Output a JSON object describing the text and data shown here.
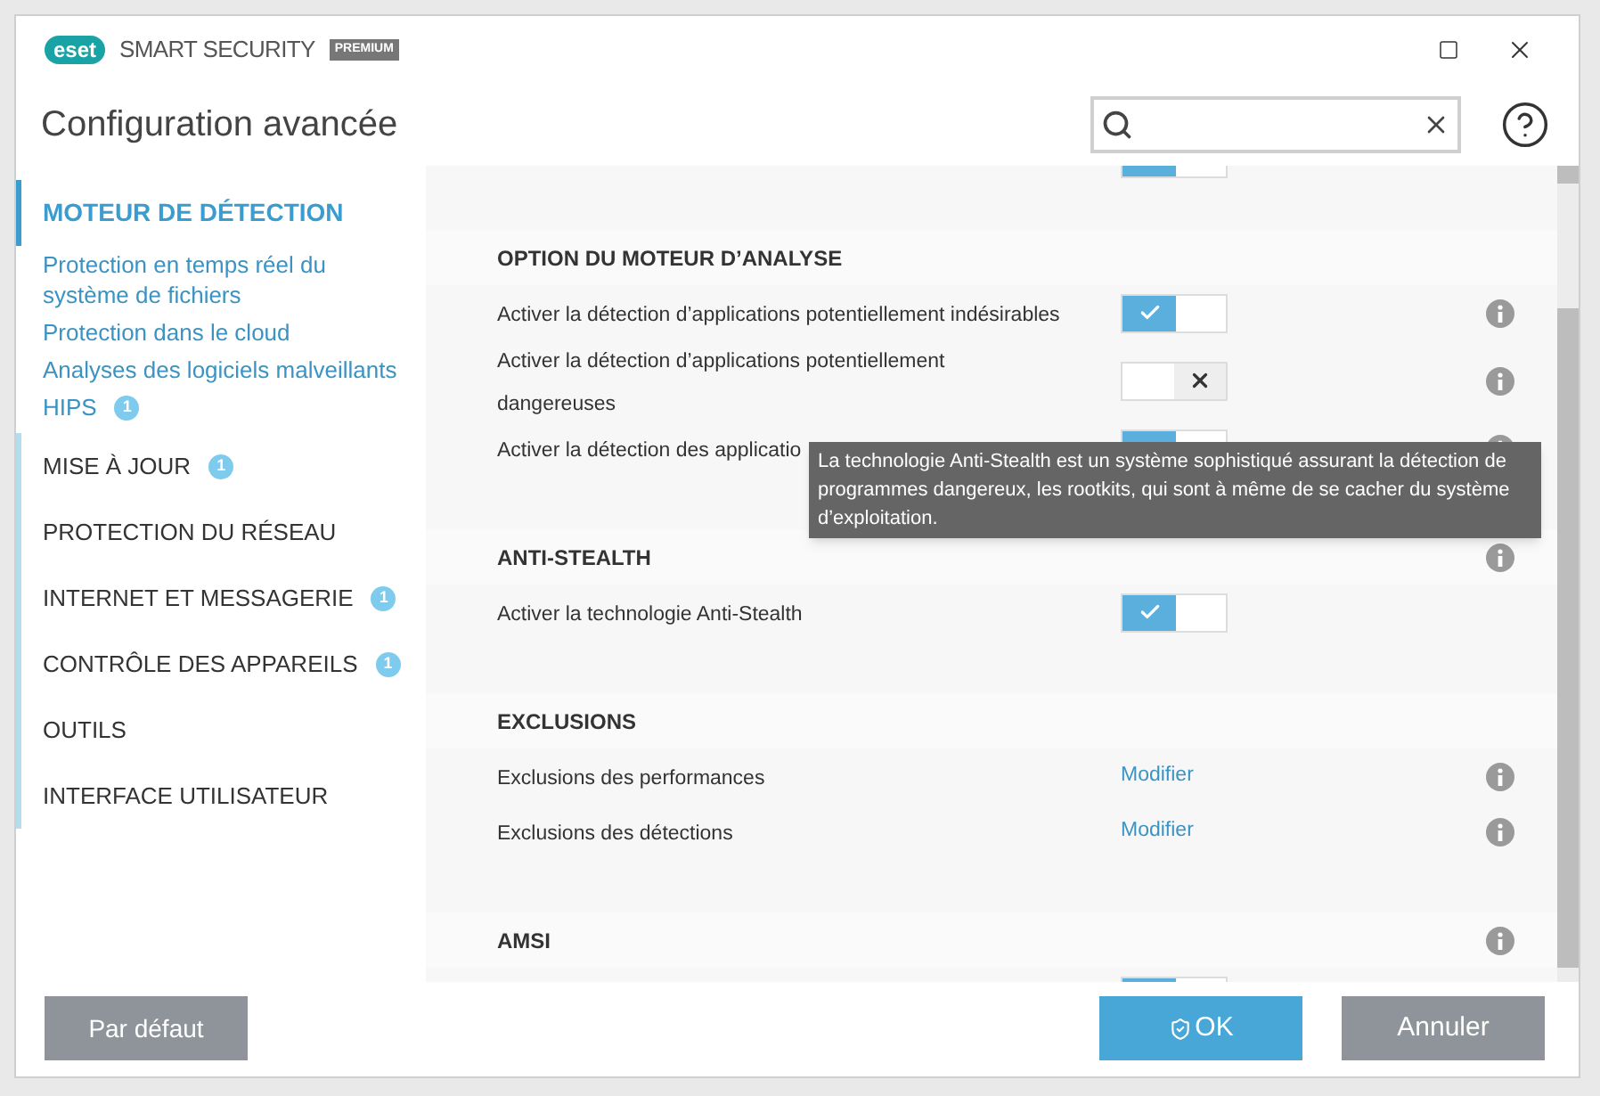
{
  "app": {
    "logo": "eset",
    "product": "SMART SECURITY",
    "edition": "PREMIUM"
  },
  "title": "Configuration avancée",
  "sidebar": {
    "items": [
      {
        "label": "MOTEUR DE DÉTECTION",
        "selected": true,
        "children": [
          {
            "label": "Protection en temps réel du système de fichiers"
          },
          {
            "label": "Protection dans le cloud"
          },
          {
            "label": "Analyses des logiciels malveillants"
          },
          {
            "label": "HIPS",
            "badge": "1"
          }
        ]
      },
      {
        "label": "MISE À JOUR",
        "selected": false,
        "badge": "1"
      },
      {
        "label": "PROTECTION DU RÉSEAU",
        "selected": false
      },
      {
        "label": "INTERNET ET MESSAGERIE",
        "selected": false,
        "badge": "1"
      },
      {
        "label": "CONTRÔLE DES APPAREILS",
        "selected": false,
        "badge": "1"
      },
      {
        "label": "OUTILS",
        "selected": false
      },
      {
        "label": "INTERFACE UTILISATEUR",
        "selected": false
      }
    ]
  },
  "sections": [
    {
      "rows": [
        {
          "kind": "toggle",
          "on": true,
          "info": false
        }
      ]
    },
    {
      "title": "OPTION DU MOTEUR D’ANALYSE",
      "info": false,
      "rows": [
        {
          "kind": "toggle",
          "label": "Activer la détection d’applications potentiellement indésirables",
          "on": true,
          "info": true
        },
        {
          "kind": "toggle",
          "label": "Activer la détection d’applications potentiellement dangereuses",
          "on": false,
          "info": true
        },
        {
          "kind": "toggle",
          "label": "Activer la détection des applicatio",
          "on": true,
          "info": true
        }
      ]
    },
    {
      "title": "ANTI-STEALTH",
      "info": true,
      "rows": [
        {
          "kind": "toggle",
          "label": "Activer la technologie Anti-Stealth",
          "on": true,
          "info": false
        }
      ]
    },
    {
      "title": "EXCLUSIONS",
      "info": false,
      "rows": [
        {
          "kind": "link",
          "label": "Exclusions des performances",
          "link": "Modifier",
          "info": true
        },
        {
          "kind": "link",
          "label": "Exclusions des détections",
          "link": "Modifier",
          "info": true
        }
      ]
    },
    {
      "title": "AMSI",
      "info": true,
      "rows": [
        {
          "kind": "toggle",
          "on": true,
          "info": false
        }
      ]
    }
  ],
  "tooltip": "La technologie Anti-Stealth est un système sophistiqué assurant la détection de programmes dangereux, les rootkits, qui sont à même de se cacher du système d’exploitation.",
  "footer": {
    "default_button": "Par défaut",
    "ok_button": "OK",
    "cancel_button": "Annuler"
  }
}
